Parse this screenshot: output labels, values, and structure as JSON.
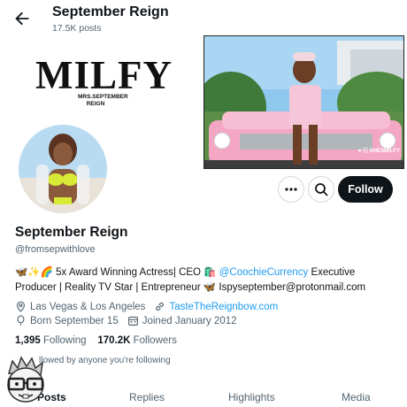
{
  "header": {
    "title": "September Reign",
    "subtitle": "17.5K posts"
  },
  "banner": {
    "logo_text": "MILFY",
    "logo_sub_line1": "MRS.SEPTEMBER",
    "logo_sub_line2": "REIGN",
    "watermark": "♥ ⓒ SHESMILFY"
  },
  "actions": {
    "follow_label": "Follow"
  },
  "profile": {
    "name": "September Reign",
    "handle": "@fromsepwithlove",
    "bio_part1": "🦋✨🌈 5x Award Winning Actress| CEO 🛍️",
    "bio_mention": "@CoochieCurrency",
    "bio_part2": " Executive Producer | Reality TV Star | Entrepreneur 🦋 Ispyseptember@protonmail.com",
    "location": "Las Vegas & Los Angeles",
    "website": "TasteTheReignbow.com",
    "birthday": "Born September 15",
    "joined": "Joined January 2012",
    "following_count": "1,395",
    "following_label": "Following",
    "followers_count": "170.2K",
    "followers_label": "Followers",
    "followed_by": "llowed by anyone you're following"
  },
  "tabs": [
    {
      "label": "Posts"
    },
    {
      "label": "Replies"
    },
    {
      "label": "Highlights"
    },
    {
      "label": "Media"
    }
  ],
  "colors": {
    "accent": "#1d9bf0",
    "text": "#0f1419",
    "muted": "#536471"
  }
}
